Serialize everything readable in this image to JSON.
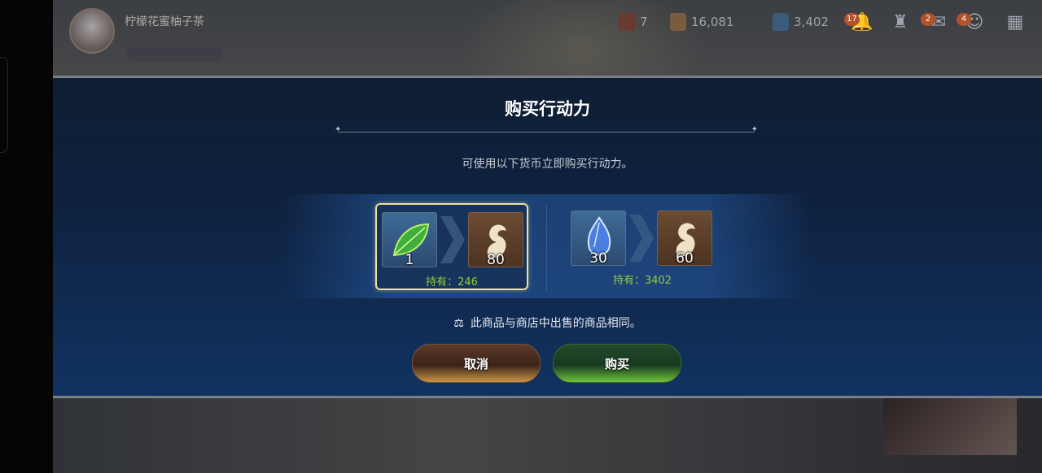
{
  "hud": {
    "player_name": "柠檬花蜜柚子茶",
    "player_tag": "",
    "player_sub": "",
    "stamina_value": "7",
    "gold_value": "16,081",
    "gem_value": "3,402",
    "badges": {
      "notifications": "17",
      "mail": "2",
      "chat": "4"
    }
  },
  "dialog": {
    "title": "购买行动力",
    "description": "可使用以下货币立即购买行动力。",
    "options": [
      {
        "cost_icon": "leaf-icon",
        "cost": "1",
        "gain_icon": "stamina-horse-icon",
        "gain": "80",
        "hold": "持有：246",
        "selected": true
      },
      {
        "cost_icon": "crystal-icon",
        "cost": "30",
        "gain_icon": "stamina-horse-icon",
        "gain": "60",
        "hold": "持有：3402",
        "selected": false
      }
    ],
    "note": "此商品与商店中出售的商品相同。",
    "cancel_label": "取消",
    "buy_label": "购买"
  },
  "colors": {
    "hold_text": "#8fcc3c",
    "selected_border": "#e8e1a2",
    "dialog_bg": "#0e223f"
  }
}
